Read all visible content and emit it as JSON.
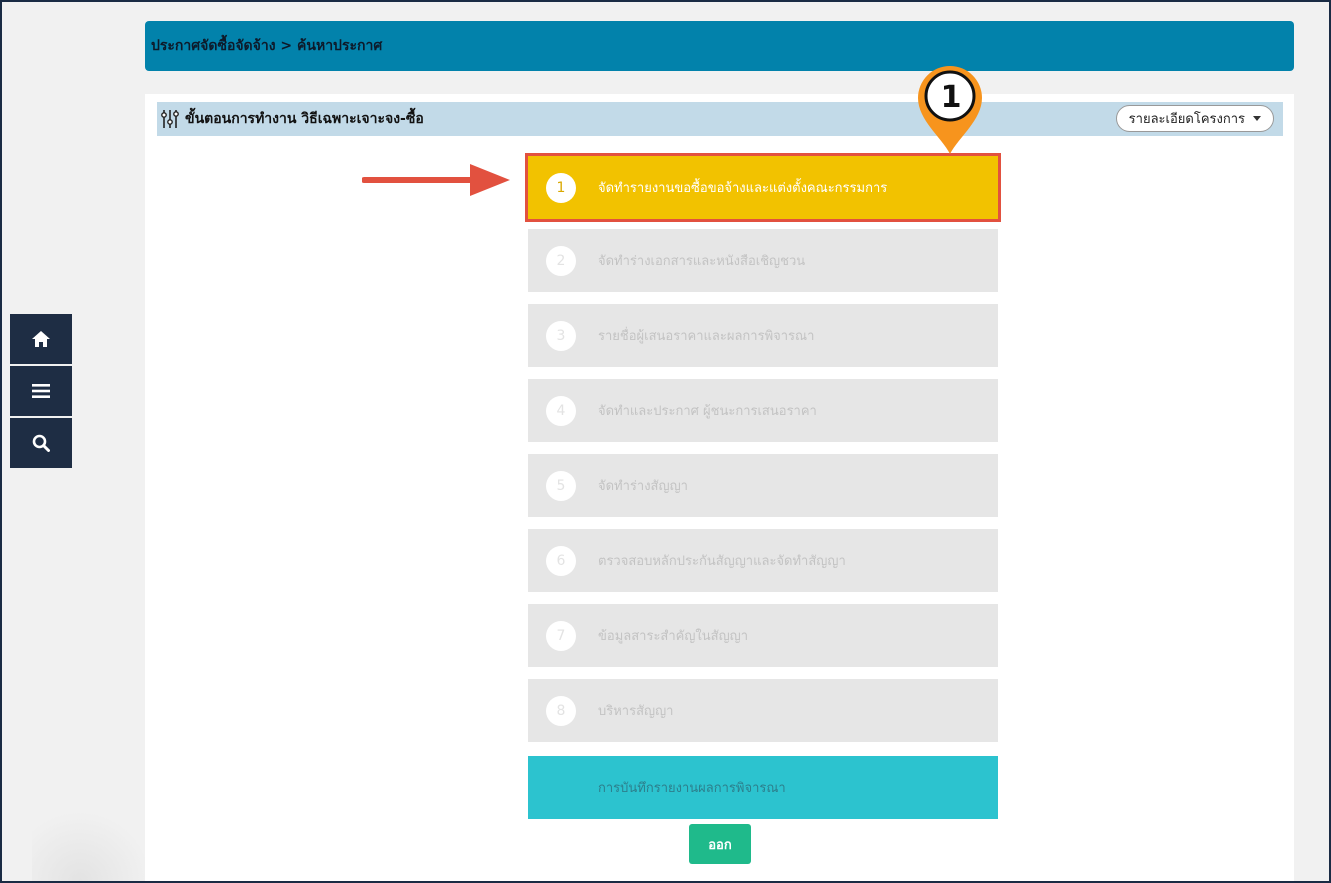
{
  "breadcrumb": "ประกาศจัดซื้อจัดจ้าง > ค้นหาประกาศ",
  "steps_header": {
    "title": "ขั้นตอนการทำงาน วิธีเฉพาะเจาะจง-ซื้อ",
    "detail_button": "รายละเอียดโครงการ"
  },
  "steps": [
    {
      "num": "1",
      "label": "จัดทำรายงานขอซื้อขอจ้างและแต่งตั้งคณะกรรมการ",
      "state": "active"
    },
    {
      "num": "2",
      "label": "จัดทำร่างเอกสารและหนังสือเชิญชวน",
      "state": "disabled"
    },
    {
      "num": "3",
      "label": "รายชื่อผู้เสนอราคาและผลการพิจารณา",
      "state": "disabled"
    },
    {
      "num": "4",
      "label": "จัดทำและประกาศ ผู้ชนะการเสนอราคา",
      "state": "disabled"
    },
    {
      "num": "5",
      "label": "จัดทำร่างสัญญา",
      "state": "disabled"
    },
    {
      "num": "6",
      "label": "ตรวจสอบหลักประกันสัญญาและจัดทำสัญญา",
      "state": "disabled"
    },
    {
      "num": "7",
      "label": "ข้อมูลสาระสำคัญในสัญญา",
      "state": "disabled"
    },
    {
      "num": "8",
      "label": "บริหารสัญญา",
      "state": "disabled"
    }
  ],
  "record_button": "การบันทึกรายงานผลการพิจารณา",
  "exit_button": "ออก",
  "annotation": {
    "number": "1"
  },
  "colors": {
    "header_bar": "#0282ab",
    "steps_header": "#c2dae8",
    "active_step": "#f2c200",
    "highlight_outline": "#e2513f",
    "record_button": "#2cc3cf",
    "exit_button": "#1fba8b",
    "side_nav": "#1e2d44",
    "pin": "#f7941d"
  },
  "side_nav": [
    "home-icon",
    "menu-icon",
    "search-icon"
  ]
}
